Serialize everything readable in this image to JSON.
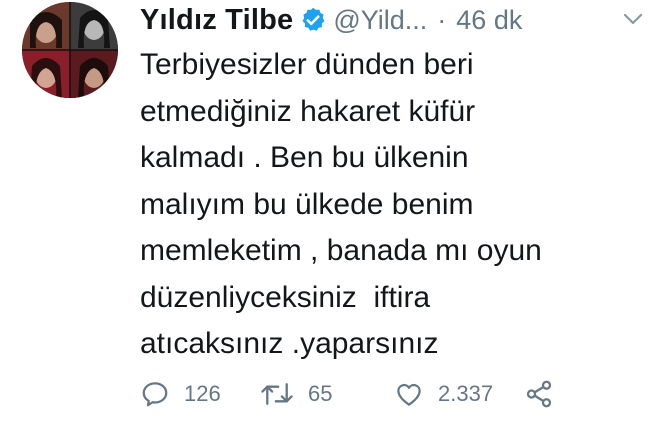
{
  "tweet": {
    "display_name": "Yıldız Tilbe",
    "handle": "@Yild...",
    "separator": "·",
    "time": "46 dk",
    "text_lines": [
      "Terbiyesizler dünden beri",
      "etmediğiniz hakaret küfür",
      "kalmadı . Ben bu ülkenin",
      "malıyım bu ülkede benim",
      "memleketim , banada mı oyun",
      "düzenliyceksiniz  iftira",
      "atıcaksınız .yaparsınız"
    ]
  },
  "actions": {
    "reply_count": "126",
    "retweet_count": "65",
    "like_count": "2.337"
  },
  "icons": {
    "verified": "verified-badge-icon",
    "caret": "chevron-down-icon",
    "reply": "reply-icon",
    "retweet": "retweet-icon",
    "like": "heart-icon",
    "share": "share-icon"
  },
  "colors": {
    "text": "#14171a",
    "secondary": "#657786",
    "verified": "#1da1f2"
  }
}
